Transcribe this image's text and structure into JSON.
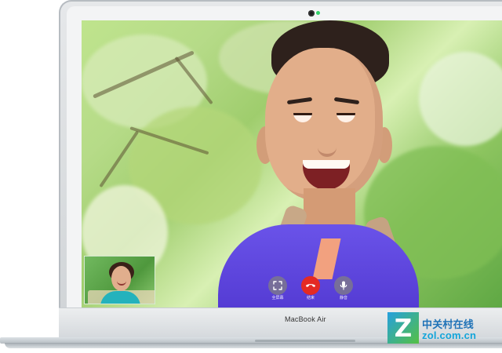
{
  "device": {
    "brand_label": "MacBook Air"
  },
  "facetime": {
    "controls": {
      "fullscreen_label": "全屏幕",
      "end_call_label": "结束",
      "mute_label": "静音"
    },
    "icons": {
      "fullscreen": "fullscreen-icon",
      "end_call": "phone-hangup-icon",
      "mute": "microphone-icon"
    },
    "colors": {
      "end_call": "#e42a24",
      "camera_led": "#34d26b"
    }
  },
  "watermark": {
    "chinese": "中关村在线",
    "domain": "zol.com.cn",
    "logo_letter": "Z"
  }
}
